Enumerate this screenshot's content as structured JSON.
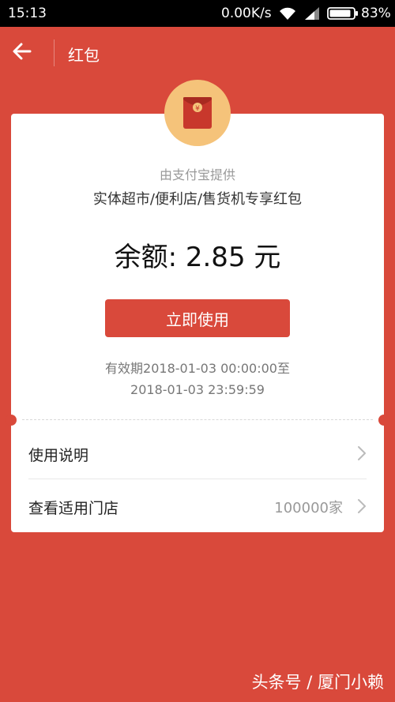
{
  "status_bar": {
    "time": "15:13",
    "net_speed": "0.00K/s",
    "battery": "83%"
  },
  "header": {
    "title": "红包",
    "back_icon": "arrow-left-icon"
  },
  "card": {
    "badge_icon": "red-envelope-yuan-icon",
    "provider": "由支付宝提供",
    "description": "实体超市/便利店/售货机专享红包",
    "balance": "余额: 2.85 元",
    "use_button_label": "立即使用",
    "validity_line1": "有效期2018-01-03 00:00:00至",
    "validity_line2": "2018-01-03 23:59:59",
    "rows": [
      {
        "label": "使用说明",
        "value": ""
      },
      {
        "label": "查看适用门店",
        "value": "100000家"
      }
    ]
  },
  "watermark": "头条号 / 厦门小赖",
  "colors": {
    "primary_red": "#d9493b",
    "badge_gold": "#f5c37a"
  }
}
